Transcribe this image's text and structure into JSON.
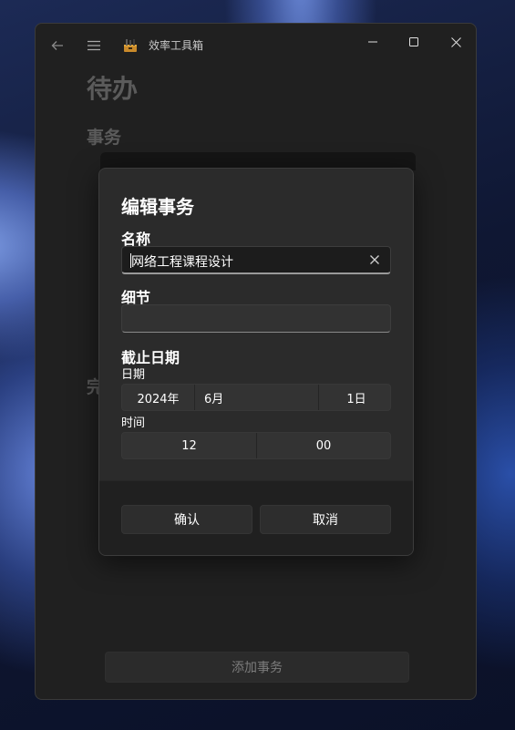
{
  "app": {
    "title": "效率工具箱",
    "icons": {
      "back": "back-arrow-icon",
      "menu": "hamburger-menu-icon",
      "app": "toolbox-icon",
      "minimize": "minimize-icon",
      "maximize": "maximize-icon",
      "close": "close-icon"
    }
  },
  "page": {
    "title": "待办",
    "section_events": "事务",
    "section_done": "完",
    "add_button": "添加事务"
  },
  "dialog": {
    "title": "编辑事务",
    "name_label": "名称",
    "name_value": "网络工程课程设计",
    "detail_label": "细节",
    "detail_value": "",
    "deadline_label": "截止日期",
    "date_label": "日期",
    "date": {
      "year": "2024年",
      "month": "6月",
      "day": "1日"
    },
    "time_label": "时间",
    "time": {
      "hour": "12",
      "minute": "00"
    },
    "confirm": "确认",
    "cancel": "取消"
  },
  "colors": {
    "window_bg": "#202020",
    "dialog_bg": "#2b2b2b",
    "dialog_footer_bg": "#202020",
    "text_primary": "#ffffff",
    "text_dimmed": "#5b5b5b"
  }
}
